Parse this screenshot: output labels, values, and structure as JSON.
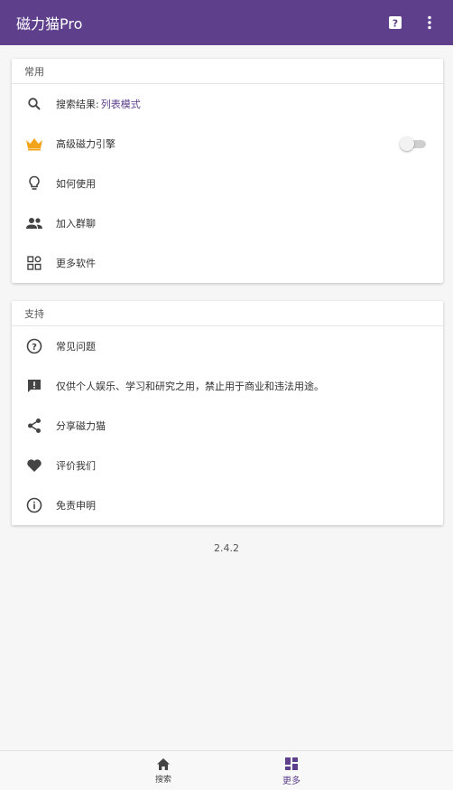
{
  "appbar": {
    "title": "磁力猫Pro",
    "help_icon": "help-box-icon",
    "more_icon": "more-vert-icon",
    "color": "#5d3f8c"
  },
  "common_card": {
    "header": "常用",
    "items": [
      {
        "icon": "search-icon",
        "label": "搜索结果:",
        "value": "列表模式"
      },
      {
        "icon": "crown-icon",
        "label": "高级磁力引擎",
        "toggle": false
      },
      {
        "icon": "lightbulb-icon",
        "label": "如何使用"
      },
      {
        "icon": "group-icon",
        "label": "加入群聊"
      },
      {
        "icon": "apps-icon",
        "label": "更多软件"
      }
    ]
  },
  "support_card": {
    "header": "支持",
    "items": [
      {
        "icon": "help-circle-icon",
        "label": "常见问题"
      },
      {
        "icon": "feedback-icon",
        "label": "仅供个人娱乐、学习和研究之用，禁止用于商业和违法用途。"
      },
      {
        "icon": "share-icon",
        "label": "分享磁力猫"
      },
      {
        "icon": "heart-icon",
        "label": "评价我们"
      },
      {
        "icon": "info-icon",
        "label": "免责申明"
      }
    ]
  },
  "version": "2.4.2",
  "bottom_nav": {
    "items": [
      {
        "icon": "home-icon",
        "label": "搜索",
        "active": false
      },
      {
        "icon": "dashboard-icon",
        "label": "更多",
        "active": true
      }
    ]
  }
}
